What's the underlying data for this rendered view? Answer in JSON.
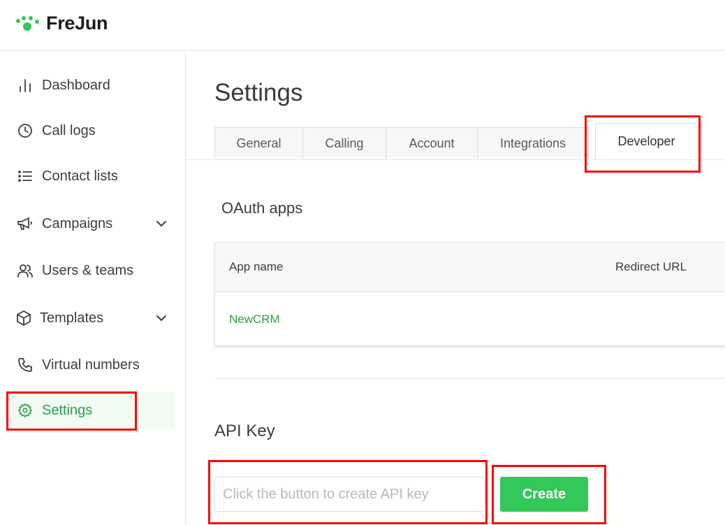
{
  "brand": {
    "name": "FreJun",
    "accent": "#34c759"
  },
  "sidebar": {
    "items": [
      {
        "label": "Dashboard",
        "icon": "bar-chart-icon"
      },
      {
        "label": "Call logs",
        "icon": "clock-icon"
      },
      {
        "label": "Contact lists",
        "icon": "list-icon"
      },
      {
        "label": "Campaigns",
        "icon": "megaphone-icon",
        "expandable": true
      },
      {
        "label": "Users & teams",
        "icon": "users-icon"
      },
      {
        "label": "Templates",
        "icon": "cube-icon",
        "expandable": true
      },
      {
        "label": "Virtual numbers",
        "icon": "phone-icon"
      },
      {
        "label": "Settings",
        "icon": "gear-icon",
        "active": true
      }
    ]
  },
  "main": {
    "title": "Settings",
    "tabs": [
      {
        "label": "General"
      },
      {
        "label": "Calling"
      },
      {
        "label": "Account"
      },
      {
        "label": "Integrations"
      },
      {
        "label": "Developer",
        "active": true
      }
    ],
    "oauth": {
      "title": "OAuth apps",
      "columns": [
        "App name",
        "Redirect URL"
      ],
      "rows": [
        {
          "app_name": "NewCRM",
          "redirect_url": ""
        }
      ]
    },
    "api_key": {
      "title": "API Key",
      "placeholder": "Click the button to create API key",
      "value": "",
      "button_label": "Create"
    }
  }
}
